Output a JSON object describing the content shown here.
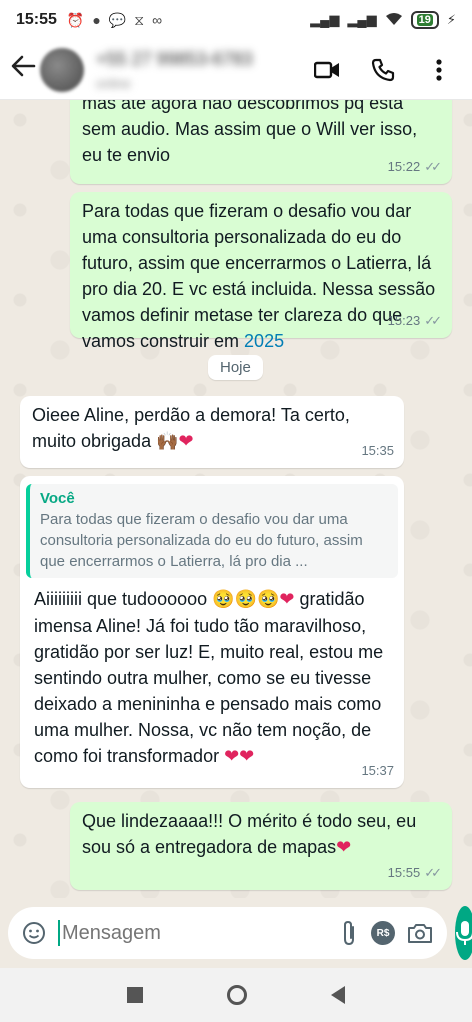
{
  "status_bar": {
    "time": "15:55",
    "battery": "19"
  },
  "header": {
    "contact_name": "+55 27 99853-6783",
    "contact_sub": "online"
  },
  "messages": [
    {
      "dir": "out",
      "text": "mas até agora não descobrimos pq esta sem audio. Mas assim que o Will ver isso, eu te envio",
      "time": "15:22"
    },
    {
      "dir": "out",
      "text": "Para todas que fizeram o desafio vou dar uma consultoria personalizada do eu do futuro, assim que encerrarmos o Latierra, lá pro dia 20. E vc está incluida. Nessa sessão vamos definir metase ter clareza do que vamos construir em ",
      "link": "2025",
      "time": "15:23"
    },
    {
      "dir": "in",
      "text": "Oieee Aline, perdão a demora! Ta certo, muito obrigada",
      "time": "15:35"
    },
    {
      "dir": "in",
      "quote_author": "Você",
      "quote_text": "Para todas que fizeram o desafio vou dar uma consultoria personalizada do eu do futuro, assim que encerrarmos o Latierra, lá pro dia ...",
      "text": "Aiiiiiiiii que tudoooooo",
      "text2": "gratidão imensa Aline! Já foi tudo tão maravilhoso, gratidão por ser luz! E, muito real, estou me sentindo outra mulher, como se eu tivesse deixado a menininha e pensado mais como uma mulher. Nossa, vc não tem noção, de como foi transformador",
      "time": "15:37"
    },
    {
      "dir": "out",
      "text": "Que lindezaaaa!!! O mérito é todo seu, eu sou só a entregadora de mapas",
      "time": "15:55"
    }
  ],
  "date_chip": "Hoje",
  "input": {
    "placeholder": "Mensagem"
  },
  "icons": {
    "back": "arrow-left-icon",
    "video": "video-call-icon",
    "call": "phone-icon",
    "menu": "more-vert-icon",
    "emoji": "emoji-icon",
    "attach": "paperclip-icon",
    "payment": "payment-icon",
    "camera": "camera-icon",
    "mic": "mic-icon"
  },
  "colors": {
    "outgoing_bubble": "#d9fdd3",
    "incoming_bubble": "#ffffff",
    "accent": "#00a884",
    "chat_background": "#efeae2"
  }
}
